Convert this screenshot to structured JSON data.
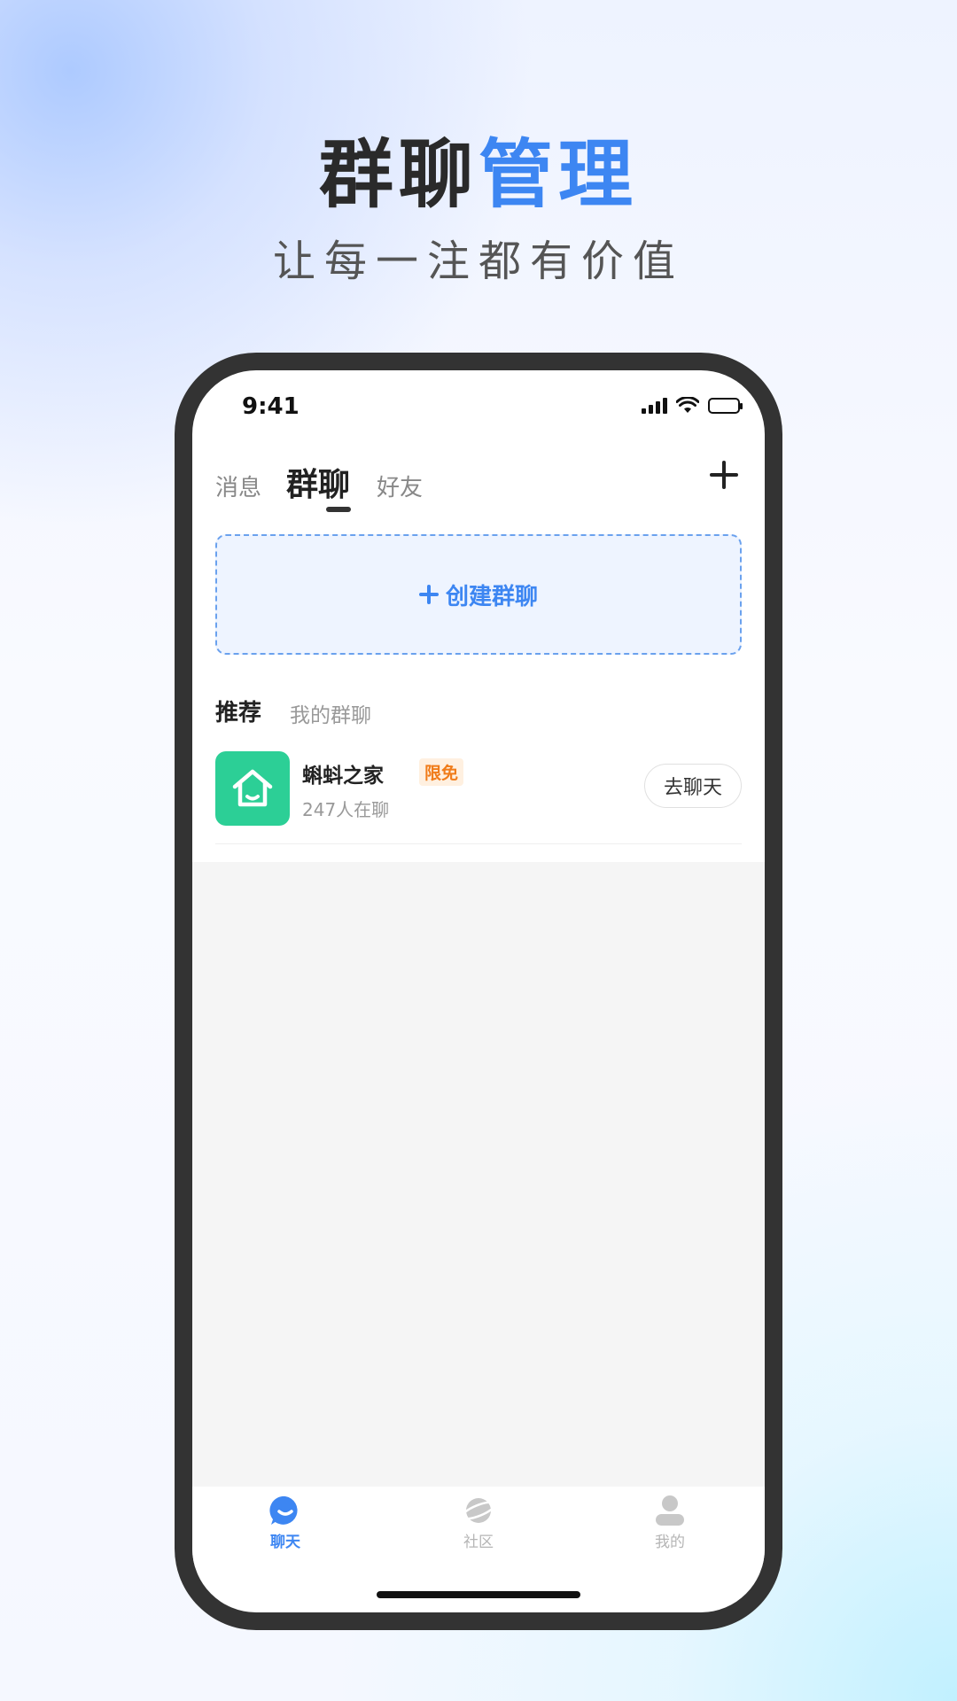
{
  "headline": {
    "dark": "群聊",
    "accent": "管理"
  },
  "subtitle": "让每一注都有价值",
  "status": {
    "time": "9:41"
  },
  "tabs": {
    "messages": "消息",
    "groups": "群聊",
    "friends": "好友"
  },
  "create": {
    "label": "创建群聊"
  },
  "sections": {
    "recommend": "推荐",
    "my_groups": "我的群聊"
  },
  "group": {
    "name": "蝌蚪之家",
    "badge": "限免",
    "members": "247人在聊",
    "button": "去聊天"
  },
  "nav": {
    "chat": "聊天",
    "community": "社区",
    "mine": "我的"
  },
  "colors": {
    "accent": "#3d86f2",
    "avatar": "#2ccf96",
    "badge": "#f07c1a"
  }
}
